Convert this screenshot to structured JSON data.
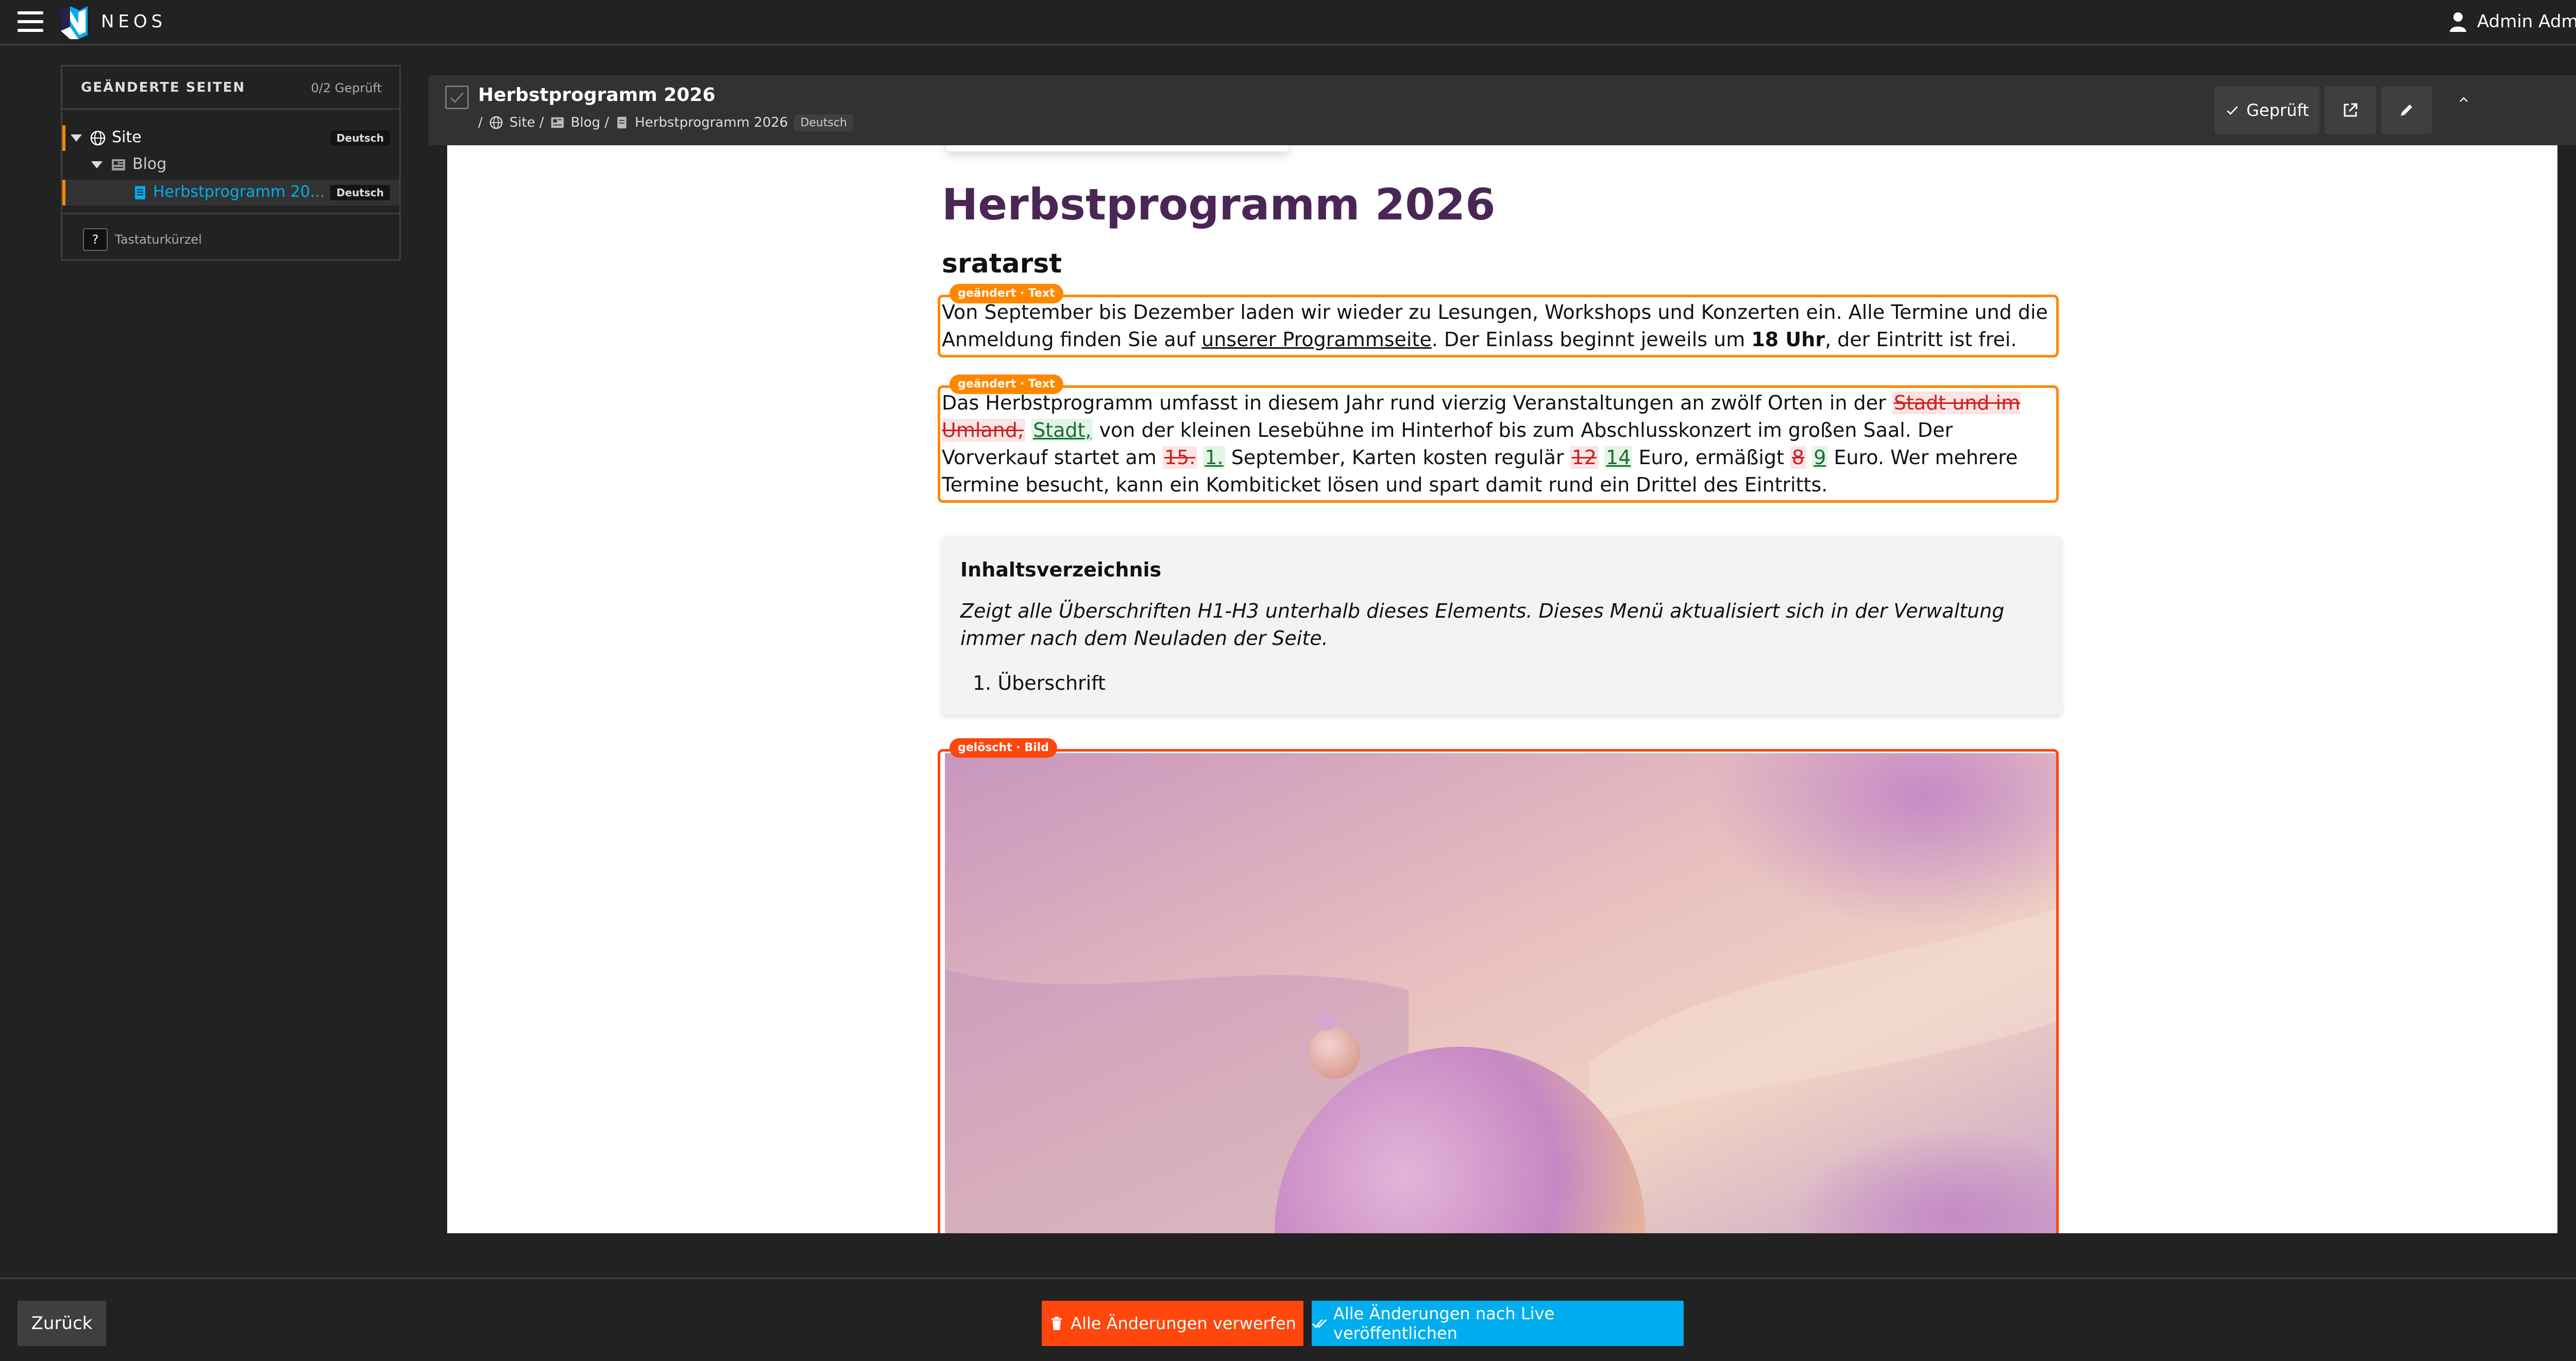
{
  "app": {
    "logo_text": "NEOS",
    "user_name": "Admin Admin"
  },
  "sidebar": {
    "title": "GEÄNDERTE SEITEN",
    "count": "0/2 Geprüft",
    "tree": [
      {
        "label": "Site",
        "badge": "Deutsch",
        "icon": "globe-icon"
      },
      {
        "label": "Blog",
        "icon": "news-icon"
      },
      {
        "label": "Herbstprogramm 20...",
        "badge": "Deutsch",
        "icon": "document-icon"
      }
    ],
    "shortcut_key": "?",
    "shortcut_label": "Tastaturkürzel"
  },
  "preview_header": {
    "title": "Herbstprogramm 2026",
    "breadcrumb": [
      "/",
      "Site /",
      "Blog /",
      "Herbstprogramm 2026"
    ],
    "breadcrumb_badge": "Deutsch",
    "reviewed_label": "Geprüft"
  },
  "page": {
    "h1": "Herbstprogramm 2026",
    "h2": "sratarst",
    "tag_changed_text": "geändert · Text",
    "tag_deleted_image": "gelöscht · Bild",
    "para1": {
      "t1": "Von September bis Dezember laden wir wieder zu Lesungen, Workshops und Konzerten ein. Alle Termine und die Anmeldung finden Sie auf ",
      "link": "unserer Programmseite",
      "t2": ". Der Einlass beginnt jeweils um ",
      "bold": "18 Uhr",
      "t3": ", der Eintritt ist frei."
    },
    "para2": {
      "t1": "Das Herbstprogramm umfasst in diesem Jahr rund vierzig Veranstaltungen an zwölf Orten in der ",
      "del1": "Stadt und im Umland,",
      "ins1": "Stadt,",
      "t2": " von der kleinen Lesebühne im Hinterhof bis zum Abschlusskonzert im großen Saal. Der Vorverkauf startet am ",
      "del2": "15.",
      "ins2": "1.",
      "t3": " September, Karten kosten regulär ",
      "del3": "12",
      "ins3": "14",
      "t4": " Euro, ermäßigt ",
      "del4": "8",
      "ins4": "9",
      "t5": " Euro. Wer mehrere Termine besucht, kann ein Kombiticket lösen und spart damit rund ein Drittel des Eintritts."
    },
    "toc": {
      "title": "Inhaltsverzeichnis",
      "description": "Zeigt alle Überschriften H1-H3 unterhalb dieses Elements. Dieses Menü aktualisiert sich in der Verwaltung immer nach dem Neuladen der Seite.",
      "item": "1. Überschrift"
    }
  },
  "bottom": {
    "back_label": "Zurück",
    "discard_label": "Alle Änderungen verwerfen",
    "publish_label": "Alle Änderungen nach Live veröffentlichen"
  },
  "colors": {
    "accent_orange": "#ff8700",
    "danger": "#ff460d",
    "primary_blue": "#00adee",
    "heading_purple": "#4a2656"
  }
}
